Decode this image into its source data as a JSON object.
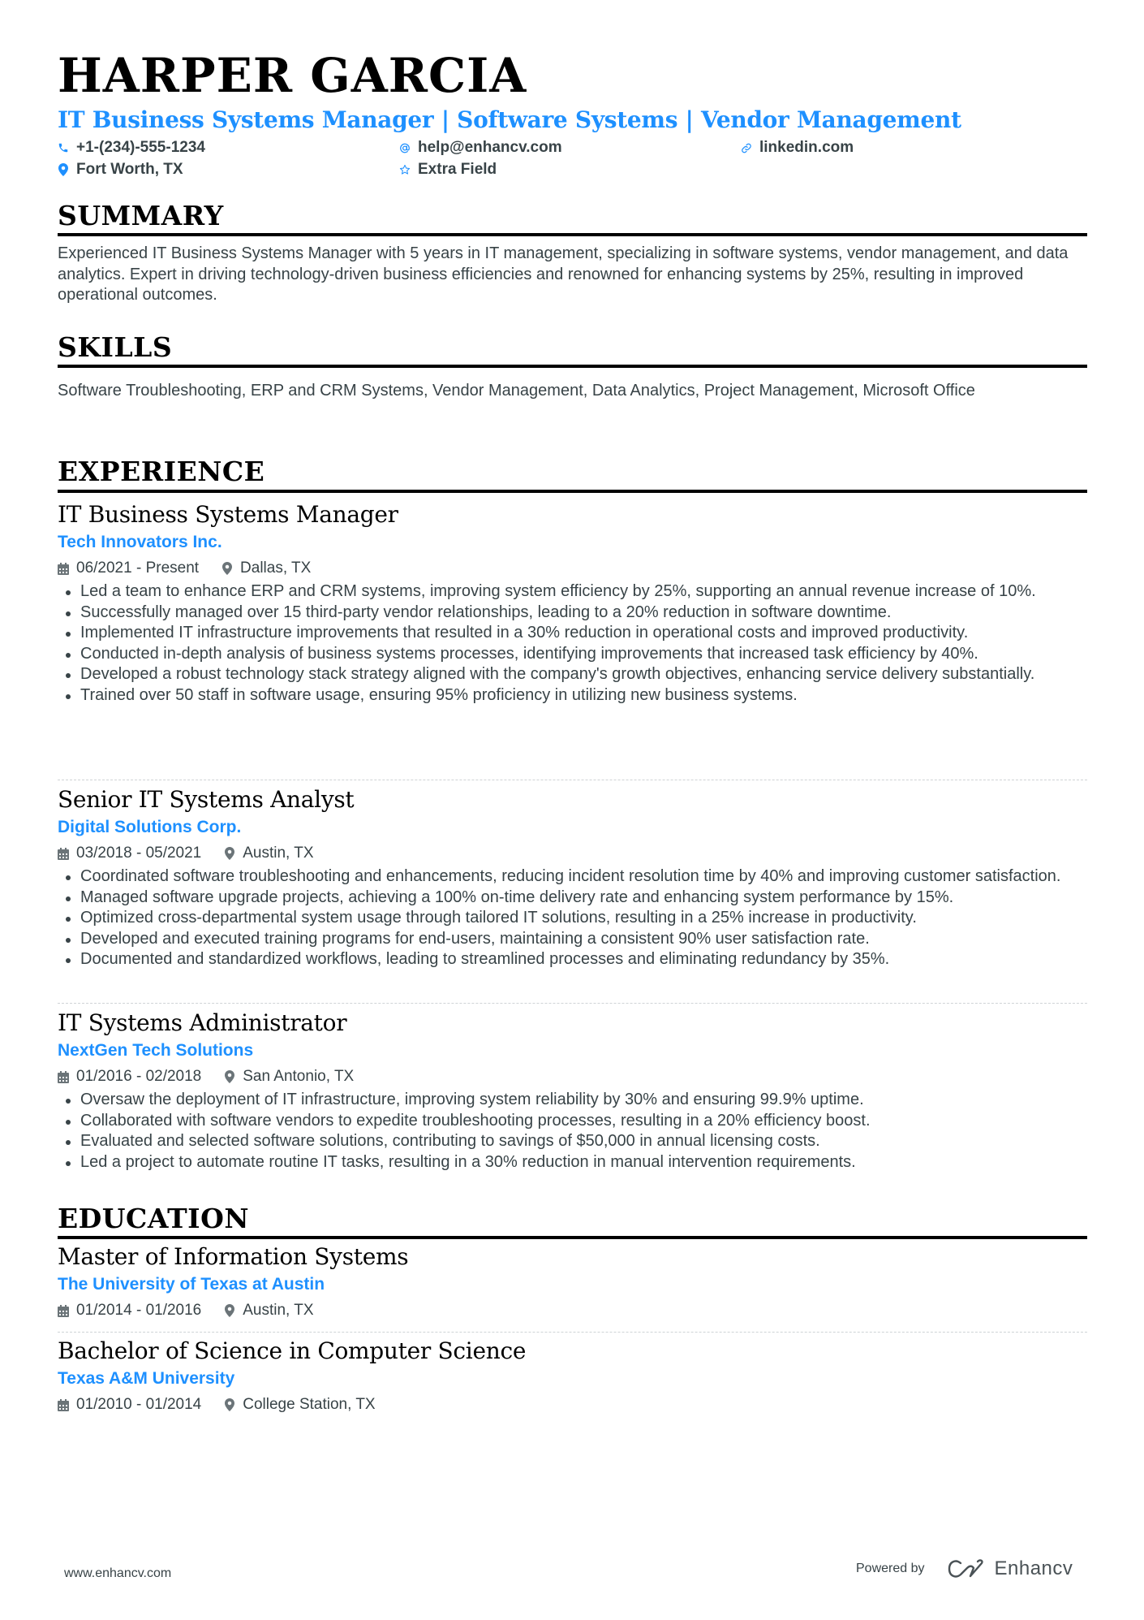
{
  "header": {
    "name": "HARPER GARCIA",
    "headline": "IT Business Systems Manager | Software Systems | Vendor Management",
    "contact": {
      "phone": {
        "icon": "phone-icon",
        "text": "+1-(234)-555-1234"
      },
      "email": {
        "icon": "at-icon",
        "text": "help@enhancv.com"
      },
      "link": {
        "icon": "link-icon",
        "text": "linkedin.com"
      },
      "location": {
        "icon": "map-pin-icon",
        "text": "Fort Worth, TX"
      },
      "extra": {
        "icon": "star-icon",
        "text": "Extra Field"
      }
    }
  },
  "colors": {
    "accent": "#1e90ff",
    "heading": "#000000",
    "body": "#384347",
    "divider": "#cfd3d6"
  },
  "summary": {
    "title": "SUMMARY",
    "text": "Experienced IT Business Systems Manager with 5 years in IT management, specializing in software systems, vendor management, and data analytics. Expert in driving technology-driven business efficiencies and renowned for enhancing systems by 25%, resulting in improved operational outcomes."
  },
  "skills": {
    "title": "SKILLS",
    "text": "Software Troubleshooting, ERP and CRM Systems, Vendor Management, Data Analytics, Project Management, Microsoft Office"
  },
  "experience": {
    "title": "EXPERIENCE",
    "jobs": [
      {
        "title": "IT Business Systems Manager",
        "company": "Tech Innovators Inc.",
        "dates": "06/2021 - Present",
        "location": "Dallas, TX",
        "bullets": [
          "Led a team to enhance ERP and CRM systems, improving system efficiency by 25%, supporting an annual revenue increase of 10%.",
          "Successfully managed over 15 third-party vendor relationships, leading to a 20% reduction in software downtime.",
          "Implemented IT infrastructure improvements that resulted in a 30% reduction in operational costs and improved productivity.",
          "Conducted in-depth analysis of business systems processes, identifying improvements that increased task efficiency by 40%.",
          "Developed a robust technology stack strategy aligned with the company's growth objectives, enhancing service delivery substantially.",
          "Trained over 50 staff in software usage, ensuring 95% proficiency in utilizing new business systems."
        ]
      },
      {
        "title": "Senior IT Systems Analyst",
        "company": "Digital Solutions Corp.",
        "dates": "03/2018 - 05/2021",
        "location": "Austin, TX",
        "bullets": [
          "Coordinated software troubleshooting and enhancements, reducing incident resolution time by 40% and improving customer satisfaction.",
          "Managed software upgrade projects, achieving a 100% on-time delivery rate and enhancing system performance by 15%.",
          "Optimized cross-departmental system usage through tailored IT solutions, resulting in a 25% increase in productivity.",
          "Developed and executed training programs for end-users, maintaining a consistent 90% user satisfaction rate.",
          "Documented and standardized workflows, leading to streamlined processes and eliminating redundancy by 35%."
        ]
      },
      {
        "title": "IT Systems Administrator",
        "company": "NextGen Tech Solutions",
        "dates": "01/2016 - 02/2018",
        "location": "San Antonio, TX",
        "bullets": [
          "Oversaw the deployment of IT infrastructure, improving system reliability by 30% and ensuring 99.9% uptime.",
          "Collaborated with software vendors to expedite troubleshooting processes, resulting in a 20% efficiency boost.",
          "Evaluated and selected software solutions, contributing to savings of $50,000 in annual licensing costs.",
          "Led a project to automate routine IT tasks, resulting in a 30% reduction in manual intervention requirements."
        ]
      }
    ]
  },
  "education": {
    "title": "EDUCATION",
    "items": [
      {
        "degree": "Master of Information Systems",
        "school": "The University of Texas at Austin",
        "dates": "01/2014 - 01/2016",
        "location": "Austin, TX"
      },
      {
        "degree": "Bachelor of Science in Computer Science",
        "school": "Texas A&M University",
        "dates": "01/2010 - 01/2014",
        "location": "College Station, TX"
      }
    ]
  },
  "footer": {
    "website": "www.enhancv.com",
    "powered_by": "Powered by",
    "brand": "Enhancv"
  }
}
